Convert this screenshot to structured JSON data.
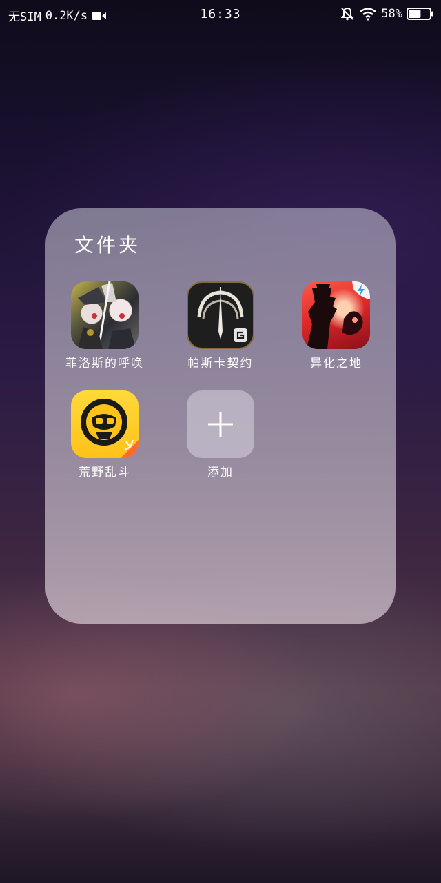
{
  "status_bar": {
    "carrier": "无SIM",
    "speed": "0.2K/s",
    "time": "16:33",
    "battery": "58%",
    "battery_level": 0.58,
    "icons": [
      "video-icon",
      "mute-bell-icon",
      "wifi-icon",
      "battery-icon"
    ]
  },
  "folder": {
    "title": "文件夹",
    "apps": [
      {
        "label": "菲洛斯的呼唤",
        "icon": "game-feiluosi-icon"
      },
      {
        "label": "帕斯卡契约",
        "icon": "game-pasika-icon"
      },
      {
        "label": "异化之地",
        "icon": "game-yihua-icon"
      },
      {
        "label": "荒野乱斗",
        "icon": "game-brawl-stars-icon"
      }
    ],
    "add_label": "添加"
  },
  "colors": {
    "folder_bg": "#b9b6c6",
    "text": "#ffffff",
    "brawl_yellow": "#ffc21a",
    "yihua_red": "#e02a2a"
  }
}
